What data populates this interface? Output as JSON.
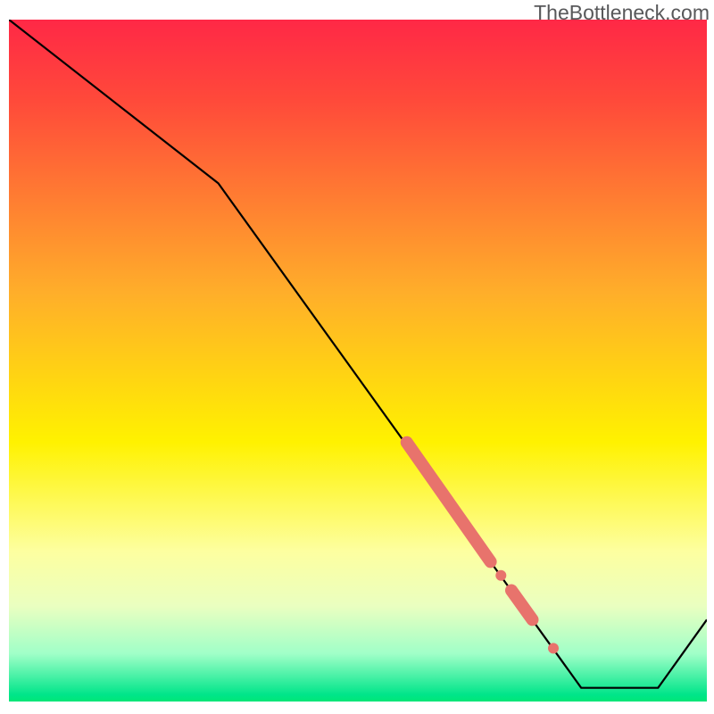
{
  "watermark": "TheBottleneck.com",
  "chart_data": {
    "type": "line",
    "title": "",
    "xlabel": "",
    "ylabel": "",
    "xlim": [
      0,
      100
    ],
    "ylim": [
      0,
      100
    ],
    "gradient_colors": {
      "top": "#ff2846",
      "upper_mid": "#ffae00",
      "mid": "#fff200",
      "lower_mid": "#d4ff80",
      "bottom": "#00e676"
    },
    "series": [
      {
        "name": "bottleneck-curve",
        "type": "line",
        "color": "#000000",
        "x": [
          0,
          30,
          82,
          93,
          100
        ],
        "values": [
          100,
          76,
          2,
          2,
          12
        ]
      },
      {
        "name": "highlight-segment-1",
        "type": "thick-line",
        "color": "#e8736c",
        "x": [
          57,
          69
        ],
        "values": [
          38,
          20.5
        ]
      },
      {
        "name": "highlight-segment-2",
        "type": "thick-line",
        "color": "#e8736c",
        "x": [
          72,
          75
        ],
        "values": [
          16.3,
          12
        ]
      },
      {
        "name": "highlight-dot-1",
        "type": "scatter",
        "color": "#e8736c",
        "x": [
          70.5
        ],
        "values": [
          18.5
        ]
      },
      {
        "name": "highlight-dot-2",
        "type": "scatter",
        "color": "#e8736c",
        "x": [
          78
        ],
        "values": [
          7.8
        ]
      }
    ]
  }
}
